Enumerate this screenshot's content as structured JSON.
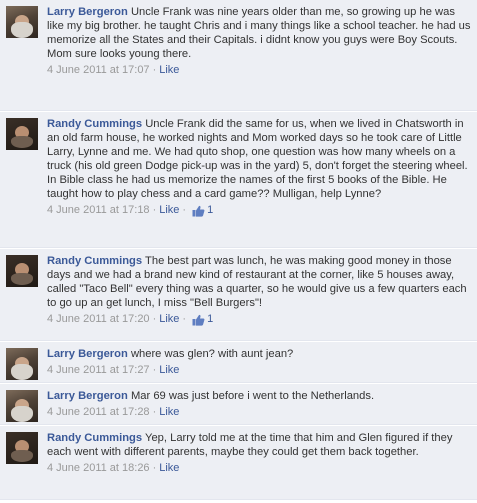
{
  "comments": [
    {
      "author": "Larry Bergeron",
      "text": "Uncle Frank was nine years older than me, so growing up he was like my big brother. he taught Chris and i many things like a school teacher. he had us memorize all the States and their Capitals. i didnt know you guys were Boy Scouts.",
      "text2": "Mom sure looks young there.",
      "timestamp": "4 June 2011 at 17:07",
      "like_label": "Like",
      "like_count": ""
    },
    {
      "author": "Randy Cummings",
      "text": "Uncle Frank did the same for us, when we lived in Chatsworth in an old farm house, he worked nights and Mom worked days so he took care of Little Larry, Lynne and me. We had quto shop, one question was how many wheels on a truck (his old green Dodge pick-up was in the yard) 5, don't forget the steering wheel. In Bible class he had us memorize the names of the first 5 books of the Bible. He taught how to play chess and a card game?? Mulligan, help Lynne?",
      "text2": "",
      "timestamp": "4 June 2011 at 17:18",
      "like_label": "Like",
      "like_count": "1"
    },
    {
      "author": "Randy Cummings",
      "text": "The best part was lunch, he was making good money in those days and we had a brand new kind of restaurant at the corner, like 5 houses away, called \"Taco Bell\" every thing was a quarter, so he would give us a few quarters each to go up an get lunch, I miss \"Bell Burgers\"!",
      "text2": "",
      "timestamp": "4 June 2011 at 17:20",
      "like_label": "Like",
      "like_count": "1"
    },
    {
      "author": "Larry Bergeron",
      "text": "where was glen? with aunt jean?",
      "text2": "",
      "timestamp": "4 June 2011 at 17:27",
      "like_label": "Like",
      "like_count": ""
    },
    {
      "author": "Larry Bergeron",
      "text": "Mar 69 was just before i went to the Netherlands.",
      "text2": "",
      "timestamp": "4 June 2011 at 17:28",
      "like_label": "Like",
      "like_count": ""
    },
    {
      "author": "Randy Cummings",
      "text": "Yep, Larry told me at the time that him and Glen figured if they each went with different parents, maybe they could get them back together.",
      "text2": "",
      "timestamp": "4 June 2011 at 18:26",
      "like_label": "Like",
      "like_count": ""
    }
  ],
  "separator": "·",
  "colors": {
    "link": "#3b5998",
    "bg": "#edeff4",
    "meta": "#999999"
  }
}
